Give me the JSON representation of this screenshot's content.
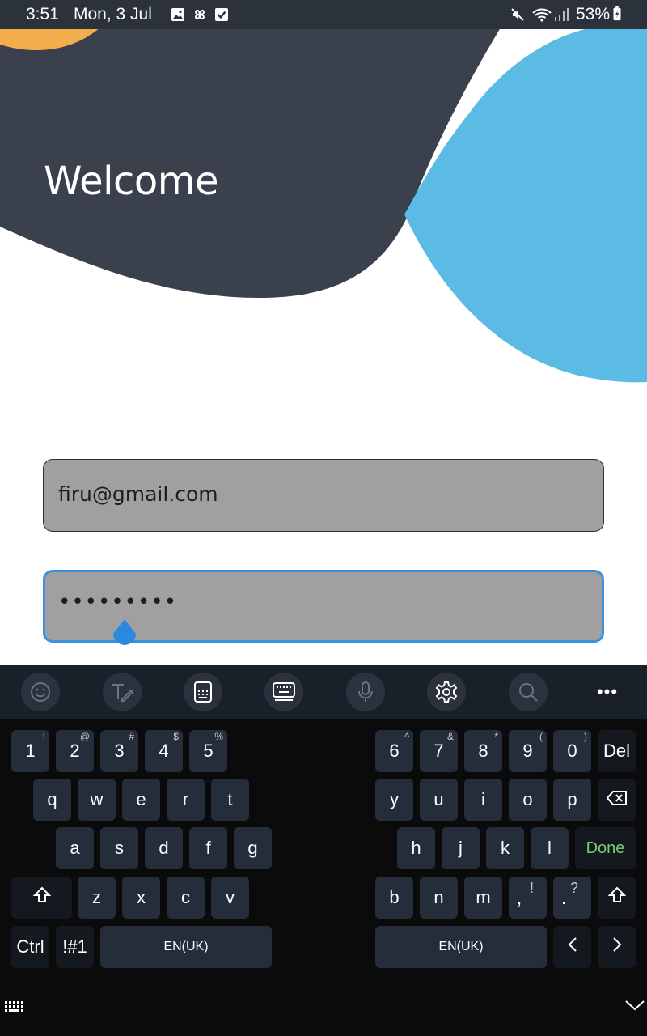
{
  "status_bar": {
    "time": "3:51",
    "date": "Mon, 3 Jul",
    "battery": "53%",
    "icons": [
      "gallery-icon",
      "pinwheel-icon",
      "checkbox-icon",
      "mute-icon",
      "wifi-icon",
      "signal-icon",
      "battery-icon"
    ]
  },
  "header": {
    "title": "Welcome"
  },
  "form": {
    "email_value": "firu@gmail.com",
    "password_value": "•••••••••"
  },
  "keyboard": {
    "toolbar": [
      "emoji-icon",
      "handwriting-icon",
      "one-hand-keyboard-icon",
      "split-keyboard-icon",
      "microphone-icon",
      "settings-icon",
      "search-icon",
      "more-icon"
    ],
    "more_label": "•••",
    "rows": {
      "numbers_left": [
        {
          "main": "1",
          "sub": "!"
        },
        {
          "main": "2",
          "sub": "@"
        },
        {
          "main": "3",
          "sub": "#"
        },
        {
          "main": "4",
          "sub": "$"
        },
        {
          "main": "5",
          "sub": "%"
        }
      ],
      "numbers_right": [
        {
          "main": "6",
          "sub": "^"
        },
        {
          "main": "7",
          "sub": "&"
        },
        {
          "main": "8",
          "sub": "*"
        },
        {
          "main": "9",
          "sub": "("
        },
        {
          "main": "0",
          "sub": ")"
        }
      ],
      "del_label": "Del",
      "row1_left": [
        "q",
        "w",
        "e",
        "r",
        "t"
      ],
      "row1_right": [
        "y",
        "u",
        "i",
        "o",
        "p"
      ],
      "row2_left": [
        "a",
        "s",
        "d",
        "f",
        "g"
      ],
      "row2_right": [
        "h",
        "j",
        "k",
        "l"
      ],
      "done_label": "Done",
      "row3_left": [
        "z",
        "x",
        "c",
        "v"
      ],
      "row3_right": [
        "b",
        "n",
        "m"
      ],
      "punct": [
        {
          "main": ",",
          "sub": "!"
        },
        {
          "main": ".",
          "sub": "?"
        }
      ],
      "ctrl_label": "Ctrl",
      "symbols_label": "!#1",
      "space_left_label": "EN(UK)",
      "space_right_label": "EN(UK)"
    }
  },
  "colors": {
    "dark_blob": "#3b414c",
    "blue_blob": "#5bbbe4",
    "orange_blob": "#f3ad4c",
    "field_bg": "#a0a0a0",
    "focus_border": "#3b90e0",
    "done_text": "#7ecb6c"
  }
}
